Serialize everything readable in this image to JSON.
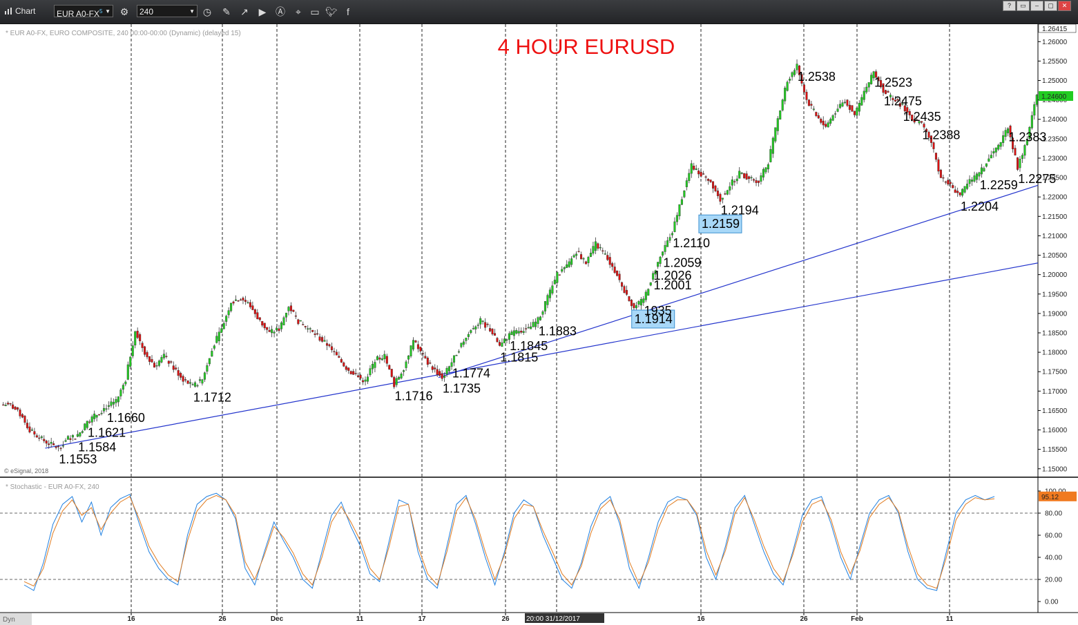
{
  "toolbar": {
    "window_title": "Chart",
    "symbol": "EUR A0-FX",
    "symbol_superscript": "5",
    "interval": "240",
    "icons": [
      "clock-icon",
      "pencil-icon",
      "line-draw-icon",
      "play-icon",
      "alert-icon",
      "tag-icon",
      "comment-icon",
      "twitter-icon",
      "facebook-icon"
    ],
    "window_buttons": [
      "?",
      "▭",
      "–",
      "▢",
      "✕"
    ]
  },
  "chart_data": [
    {
      "type": "candlestick",
      "title": "4 HOUR EURUSD",
      "subtitle": "* EUR A0-FX, EURO COMPOSITE, 240 00:00-00:00 (Dynamic) (delayed 15)",
      "copyright": "© eSignal, 2018",
      "ylim": [
        1.148,
        1.2645
      ],
      "ytick_labels": [
        "1.15000",
        "1.15500",
        "1.16000",
        "1.16500",
        "1.17000",
        "1.17500",
        "1.18000",
        "1.18500",
        "1.19000",
        "1.19500",
        "1.20000",
        "1.20500",
        "1.21000",
        "1.21500",
        "1.22000",
        "1.22500",
        "1.23000",
        "1.23500",
        "1.24000",
        "1.24500",
        "1.25000",
        "1.25500",
        "1.26000"
      ],
      "top_price_label": "1.26415",
      "current_price_label": "1.24600",
      "current_price": 1.246,
      "x_tick_labels": [
        "16",
        "26",
        "Dec",
        "11",
        "17",
        "26",
        "16",
        "26",
        "Feb",
        "11"
      ],
      "crosshair_time_label": "20:00 31/12/2017",
      "colors": {
        "up": "#22cc22",
        "down": "#dd1111",
        "trendline": "#2233cc",
        "title": "#ee1111",
        "highlight_box": "#a8d8f8"
      },
      "price_path": [
        1.1665,
        1.164,
        1.16,
        1.158,
        1.1565,
        1.1553,
        1.1578,
        1.1584,
        1.1621,
        1.164,
        1.166,
        1.1672,
        1.173,
        1.1855,
        1.18,
        1.1765,
        1.179,
        1.176,
        1.173,
        1.1712,
        1.173,
        1.181,
        1.186,
        1.193,
        1.194,
        1.192,
        1.188,
        1.185,
        1.186,
        1.192,
        1.188,
        1.186,
        1.184,
        1.182,
        1.179,
        1.176,
        1.174,
        1.1725,
        1.178,
        1.179,
        1.1716,
        1.176,
        1.183,
        1.179,
        1.176,
        1.1735,
        1.1774,
        1.182,
        1.186,
        1.188,
        1.186,
        1.1815,
        1.1845,
        1.1855,
        1.186,
        1.1883,
        1.194,
        1.2,
        1.202,
        1.206,
        1.203,
        1.208,
        1.205,
        1.201,
        1.196,
        1.1914,
        1.1935,
        1.2001,
        1.2059,
        1.211,
        1.22,
        1.228,
        1.226,
        1.224,
        1.2194,
        1.223,
        1.226,
        1.225,
        1.224,
        1.229,
        1.24,
        1.25,
        1.2538,
        1.245,
        1.241,
        1.238,
        1.242,
        1.245,
        1.241,
        1.247,
        1.2523,
        1.2475,
        1.245,
        1.2435,
        1.24,
        1.2388,
        1.234,
        1.225,
        1.223,
        1.2204,
        1.224,
        1.2259,
        1.23,
        1.233,
        1.2383,
        1.2275,
        1.235,
        1.246
      ],
      "price_labels": [
        {
          "text": "1.1553",
          "value": 1.1553,
          "at": 5
        },
        {
          "text": "1.1584",
          "value": 1.1584,
          "at": 7
        },
        {
          "text": "1.1621",
          "value": 1.1621,
          "at": 8
        },
        {
          "text": "1.1660",
          "value": 1.166,
          "at": 10
        },
        {
          "text": "1.1712",
          "value": 1.1712,
          "at": 19
        },
        {
          "text": "1.1716",
          "value": 1.1716,
          "at": 40
        },
        {
          "text": "1.1735",
          "value": 1.1735,
          "at": 45
        },
        {
          "text": "1.1774",
          "value": 1.1774,
          "at": 46
        },
        {
          "text": "1.1815",
          "value": 1.1815,
          "at": 51
        },
        {
          "text": "1.1845",
          "value": 1.1845,
          "at": 52
        },
        {
          "text": "1.1883",
          "value": 1.1883,
          "at": 55
        },
        {
          "text": "1.1914",
          "value": 1.1914,
          "at": 65,
          "boxed": true
        },
        {
          "text": "1935",
          "value": 1.1935,
          "at": 66
        },
        {
          "text": "1.2001",
          "value": 1.2001,
          "at": 67
        },
        {
          "text": "1.2026",
          "value": 1.2026,
          "at": 67
        },
        {
          "text": "1.2059",
          "value": 1.2059,
          "at": 68
        },
        {
          "text": "1.2110",
          "value": 1.211,
          "at": 69
        },
        {
          "text": "1.2159",
          "value": 1.2159,
          "at": 72,
          "boxed": true
        },
        {
          "text": "1.2194",
          "value": 1.2194,
          "at": 74
        },
        {
          "text": "1.2538",
          "value": 1.2538,
          "at": 82
        },
        {
          "text": "1.2523",
          "value": 1.2523,
          "at": 90
        },
        {
          "text": "1.2475",
          "value": 1.2475,
          "at": 91
        },
        {
          "text": "1.2435",
          "value": 1.2435,
          "at": 93
        },
        {
          "text": "1.2388",
          "value": 1.2388,
          "at": 95
        },
        {
          "text": "1.2204",
          "value": 1.2204,
          "at": 99
        },
        {
          "text": "1.2259",
          "value": 1.2259,
          "at": 101
        },
        {
          "text": "1.2383",
          "value": 1.2383,
          "at": 104
        },
        {
          "text": "1.2275",
          "value": 1.2275,
          "at": 105
        }
      ],
      "trendlines": [
        {
          "from": {
            "at": 4,
            "value": 1.1553
          },
          "to": {
            "at": 107,
            "value": 1.203
          }
        },
        {
          "from": {
            "at": 45,
            "value": 1.1735
          },
          "to": {
            "at": 107,
            "value": 1.223
          }
        }
      ]
    },
    {
      "type": "line",
      "title": "* Stochastic - EUR A0-FX, 240",
      "ylim": [
        -5,
        105
      ],
      "ytick_labels": [
        "0.00",
        "20.00",
        "40.00",
        "60.00",
        "80.00",
        "100.00"
      ],
      "reference_lines": [
        20,
        80
      ],
      "current_value_label": "95.12",
      "current_value": 95.12,
      "series": [
        {
          "color": "#1e7fe0",
          "values": [
            15,
            10,
            35,
            70,
            88,
            95,
            72,
            90,
            60,
            85,
            93,
            97,
            70,
            45,
            30,
            20,
            15,
            60,
            88,
            95,
            98,
            92,
            75,
            30,
            15,
            45,
            72,
            55,
            40,
            20,
            12,
            45,
            78,
            90,
            68,
            50,
            25,
            18,
            55,
            92,
            88,
            45,
            20,
            12,
            50,
            88,
            96,
            70,
            40,
            15,
            45,
            80,
            92,
            86,
            60,
            40,
            20,
            12,
            35,
            68,
            88,
            95,
            70,
            30,
            12,
            40,
            72,
            90,
            95,
            92,
            78,
            40,
            20,
            50,
            85,
            96,
            70,
            45,
            25,
            15,
            45,
            78,
            92,
            95,
            70,
            40,
            20,
            50,
            80,
            92,
            96,
            80,
            45,
            20,
            12,
            10,
            45,
            80,
            92,
            96,
            92,
            95
          ]
        },
        {
          "color": "#e07a1e",
          "values": [
            18,
            14,
            30,
            62,
            82,
            92,
            78,
            85,
            65,
            80,
            90,
            95,
            74,
            50,
            35,
            24,
            18,
            55,
            82,
            92,
            96,
            92,
            78,
            36,
            20,
            42,
            68,
            58,
            44,
            25,
            15,
            40,
            72,
            86,
            72,
            55,
            30,
            20,
            50,
            86,
            88,
            50,
            25,
            15,
            45,
            82,
            94,
            74,
            45,
            20,
            42,
            75,
            88,
            86,
            64,
            45,
            25,
            15,
            32,
            62,
            84,
            92,
            74,
            36,
            16,
            36,
            66,
            86,
            92,
            92,
            80,
            46,
            24,
            46,
            80,
            94,
            74,
            50,
            30,
            18,
            42,
            72,
            88,
            92,
            74,
            45,
            25,
            46,
            76,
            88,
            94,
            82,
            50,
            25,
            15,
            12,
            40,
            74,
            88,
            94,
            92,
            93
          ]
        }
      ]
    }
  ]
}
